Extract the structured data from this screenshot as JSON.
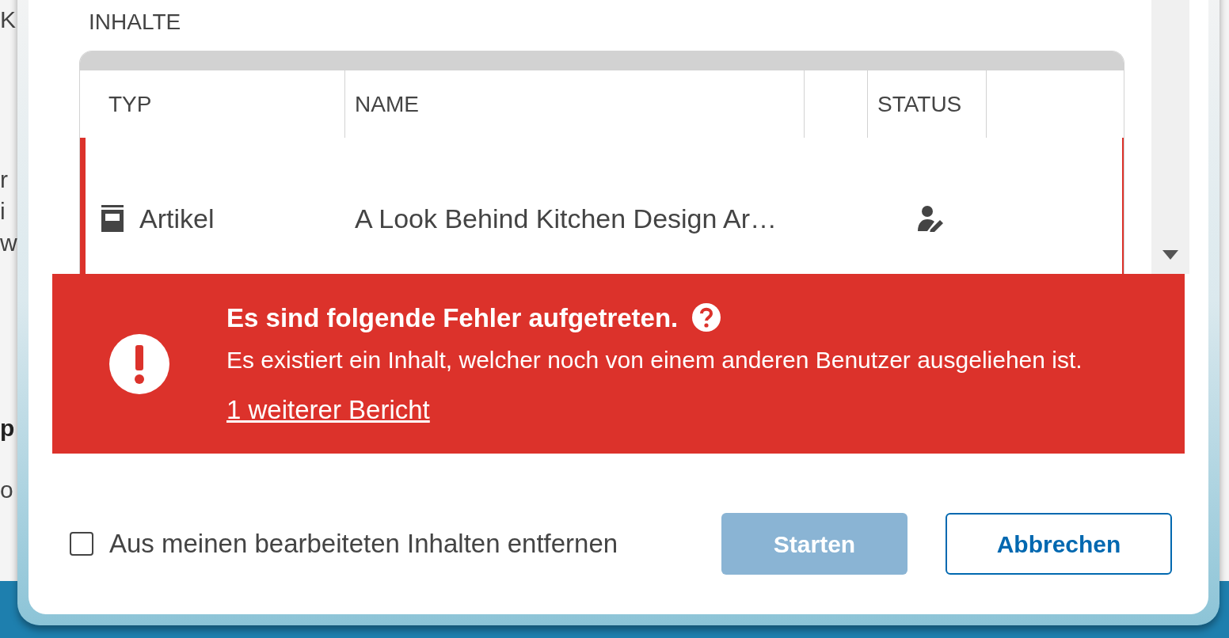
{
  "background_fragments": [
    {
      "text": "K",
      "bold": false
    },
    {
      "text": "r",
      "bold": false
    },
    {
      "text": "i",
      "bold": false
    },
    {
      "text": "w",
      "bold": false
    },
    {
      "text": "p",
      "bold": true
    },
    {
      "text": "o",
      "bold": false
    }
  ],
  "section_label": "INHALTE",
  "table": {
    "columns": [
      {
        "kind": "label",
        "label": "TYP"
      },
      {
        "kind": "label",
        "label": "NAME"
      },
      {
        "kind": "blank"
      },
      {
        "kind": "label",
        "label": "STATUS"
      },
      {
        "kind": "blank"
      }
    ],
    "rows": [
      {
        "type": "Artikel",
        "name": "A Look Behind Kitchen Design Ar…",
        "error": true
      }
    ]
  },
  "error": {
    "title": "Es sind folgende Fehler aufgetreten.",
    "message": "Es existiert ein Inhalt, welcher noch von einem anderen Benutzer ausgeliehen ist.",
    "link": "1 weiterer Bericht"
  },
  "footer": {
    "checkbox": {
      "label": "Aus meinen bearbeiteten Inhalten entfernen",
      "checked": false
    },
    "buttons": [
      {
        "label": "Starten",
        "kind": "primary",
        "disabled": true
      },
      {
        "label": "Abbrechen",
        "kind": "secondary",
        "disabled": false
      }
    ]
  }
}
